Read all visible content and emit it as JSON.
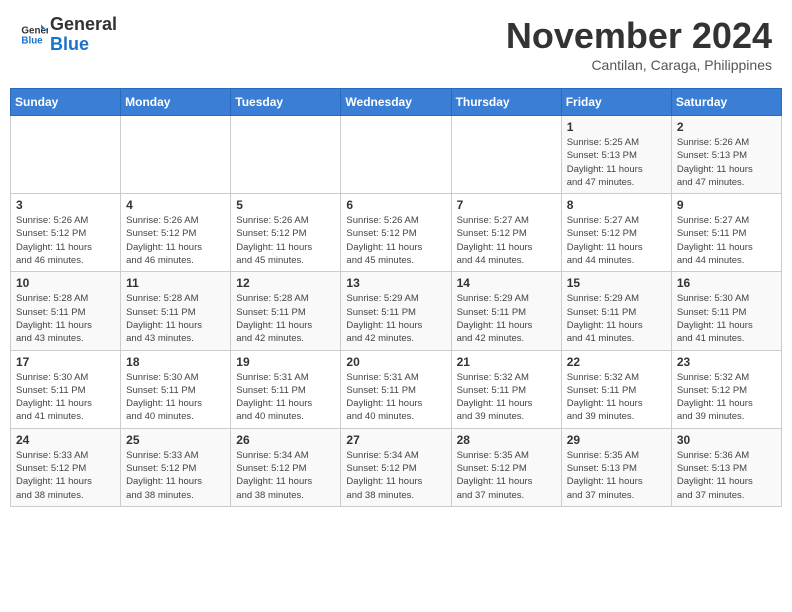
{
  "logo": {
    "line1": "General",
    "line2": "Blue"
  },
  "header": {
    "month": "November 2024",
    "location": "Cantilan, Caraga, Philippines"
  },
  "weekdays": [
    "Sunday",
    "Monday",
    "Tuesday",
    "Wednesday",
    "Thursday",
    "Friday",
    "Saturday"
  ],
  "weeks": [
    [
      {
        "day": "",
        "info": ""
      },
      {
        "day": "",
        "info": ""
      },
      {
        "day": "",
        "info": ""
      },
      {
        "day": "",
        "info": ""
      },
      {
        "day": "",
        "info": ""
      },
      {
        "day": "1",
        "info": "Sunrise: 5:25 AM\nSunset: 5:13 PM\nDaylight: 11 hours\nand 47 minutes."
      },
      {
        "day": "2",
        "info": "Sunrise: 5:26 AM\nSunset: 5:13 PM\nDaylight: 11 hours\nand 47 minutes."
      }
    ],
    [
      {
        "day": "3",
        "info": "Sunrise: 5:26 AM\nSunset: 5:12 PM\nDaylight: 11 hours\nand 46 minutes."
      },
      {
        "day": "4",
        "info": "Sunrise: 5:26 AM\nSunset: 5:12 PM\nDaylight: 11 hours\nand 46 minutes."
      },
      {
        "day": "5",
        "info": "Sunrise: 5:26 AM\nSunset: 5:12 PM\nDaylight: 11 hours\nand 45 minutes."
      },
      {
        "day": "6",
        "info": "Sunrise: 5:26 AM\nSunset: 5:12 PM\nDaylight: 11 hours\nand 45 minutes."
      },
      {
        "day": "7",
        "info": "Sunrise: 5:27 AM\nSunset: 5:12 PM\nDaylight: 11 hours\nand 44 minutes."
      },
      {
        "day": "8",
        "info": "Sunrise: 5:27 AM\nSunset: 5:12 PM\nDaylight: 11 hours\nand 44 minutes."
      },
      {
        "day": "9",
        "info": "Sunrise: 5:27 AM\nSunset: 5:11 PM\nDaylight: 11 hours\nand 44 minutes."
      }
    ],
    [
      {
        "day": "10",
        "info": "Sunrise: 5:28 AM\nSunset: 5:11 PM\nDaylight: 11 hours\nand 43 minutes."
      },
      {
        "day": "11",
        "info": "Sunrise: 5:28 AM\nSunset: 5:11 PM\nDaylight: 11 hours\nand 43 minutes."
      },
      {
        "day": "12",
        "info": "Sunrise: 5:28 AM\nSunset: 5:11 PM\nDaylight: 11 hours\nand 42 minutes."
      },
      {
        "day": "13",
        "info": "Sunrise: 5:29 AM\nSunset: 5:11 PM\nDaylight: 11 hours\nand 42 minutes."
      },
      {
        "day": "14",
        "info": "Sunrise: 5:29 AM\nSunset: 5:11 PM\nDaylight: 11 hours\nand 42 minutes."
      },
      {
        "day": "15",
        "info": "Sunrise: 5:29 AM\nSunset: 5:11 PM\nDaylight: 11 hours\nand 41 minutes."
      },
      {
        "day": "16",
        "info": "Sunrise: 5:30 AM\nSunset: 5:11 PM\nDaylight: 11 hours\nand 41 minutes."
      }
    ],
    [
      {
        "day": "17",
        "info": "Sunrise: 5:30 AM\nSunset: 5:11 PM\nDaylight: 11 hours\nand 41 minutes."
      },
      {
        "day": "18",
        "info": "Sunrise: 5:30 AM\nSunset: 5:11 PM\nDaylight: 11 hours\nand 40 minutes."
      },
      {
        "day": "19",
        "info": "Sunrise: 5:31 AM\nSunset: 5:11 PM\nDaylight: 11 hours\nand 40 minutes."
      },
      {
        "day": "20",
        "info": "Sunrise: 5:31 AM\nSunset: 5:11 PM\nDaylight: 11 hours\nand 40 minutes."
      },
      {
        "day": "21",
        "info": "Sunrise: 5:32 AM\nSunset: 5:11 PM\nDaylight: 11 hours\nand 39 minutes."
      },
      {
        "day": "22",
        "info": "Sunrise: 5:32 AM\nSunset: 5:11 PM\nDaylight: 11 hours\nand 39 minutes."
      },
      {
        "day": "23",
        "info": "Sunrise: 5:32 AM\nSunset: 5:12 PM\nDaylight: 11 hours\nand 39 minutes."
      }
    ],
    [
      {
        "day": "24",
        "info": "Sunrise: 5:33 AM\nSunset: 5:12 PM\nDaylight: 11 hours\nand 38 minutes."
      },
      {
        "day": "25",
        "info": "Sunrise: 5:33 AM\nSunset: 5:12 PM\nDaylight: 11 hours\nand 38 minutes."
      },
      {
        "day": "26",
        "info": "Sunrise: 5:34 AM\nSunset: 5:12 PM\nDaylight: 11 hours\nand 38 minutes."
      },
      {
        "day": "27",
        "info": "Sunrise: 5:34 AM\nSunset: 5:12 PM\nDaylight: 11 hours\nand 38 minutes."
      },
      {
        "day": "28",
        "info": "Sunrise: 5:35 AM\nSunset: 5:12 PM\nDaylight: 11 hours\nand 37 minutes."
      },
      {
        "day": "29",
        "info": "Sunrise: 5:35 AM\nSunset: 5:13 PM\nDaylight: 11 hours\nand 37 minutes."
      },
      {
        "day": "30",
        "info": "Sunrise: 5:36 AM\nSunset: 5:13 PM\nDaylight: 11 hours\nand 37 minutes."
      }
    ]
  ]
}
